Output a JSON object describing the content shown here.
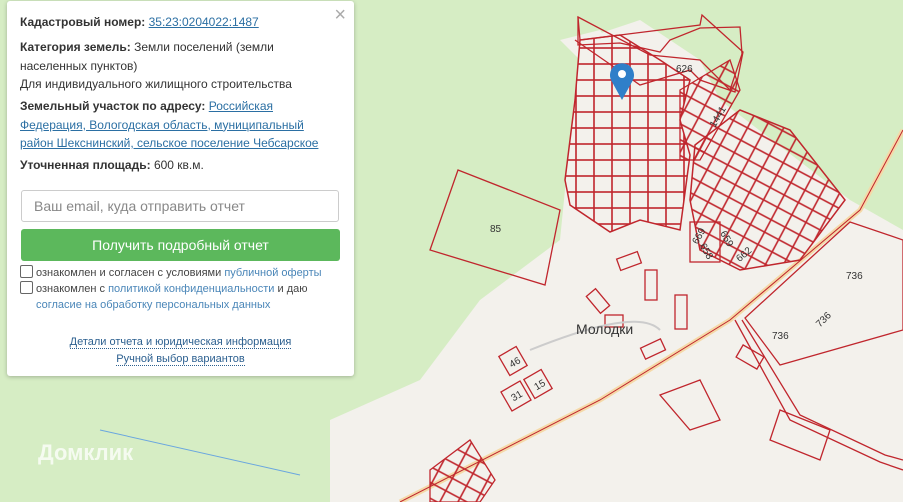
{
  "panel": {
    "cadastral_label": "Кадастровый номер:",
    "cadastral_number": "35:23:0204022:1487",
    "category_label": "Категория земель:",
    "category_value": "Земли поселений (земли населенных пунктов)",
    "usage": "Для индивидуального жилищного строительства",
    "address_label": "Земельный участок по адресу:",
    "address_value": "Российская Федерация, Вологодская область, муниципальный район Шекснинский, сельское поселение Чебсарское",
    "area_label": "Уточненная площадь:",
    "area_value": "600 кв.м.",
    "email_placeholder": "Ваш email, куда отправить отчет",
    "submit_label": "Получить подробный отчет",
    "consent1_text": "ознакомлен и согласен с условиями",
    "consent1_link": "публичной оферты",
    "consent2_text": "ознакомлен с",
    "consent2_link": "политикой конфиденциальности",
    "consent2_mid": "и даю",
    "consent2_link2": "согласие на обработку персональных данных",
    "details_link": "Детали отчета и юридическая информация",
    "manual_link": "Ручной выбор вариантов",
    "close_icon": "×"
  },
  "map": {
    "village": "Молодки",
    "parcel_labels": [
      "626",
      "1441",
      "85",
      "669",
      "659",
      "658",
      "662",
      "736",
      "736",
      "736",
      "46",
      "15",
      "31"
    ],
    "watermark": "Домклик",
    "parcel_color": "#c0262d",
    "marker_color": "#2f7fc9"
  }
}
